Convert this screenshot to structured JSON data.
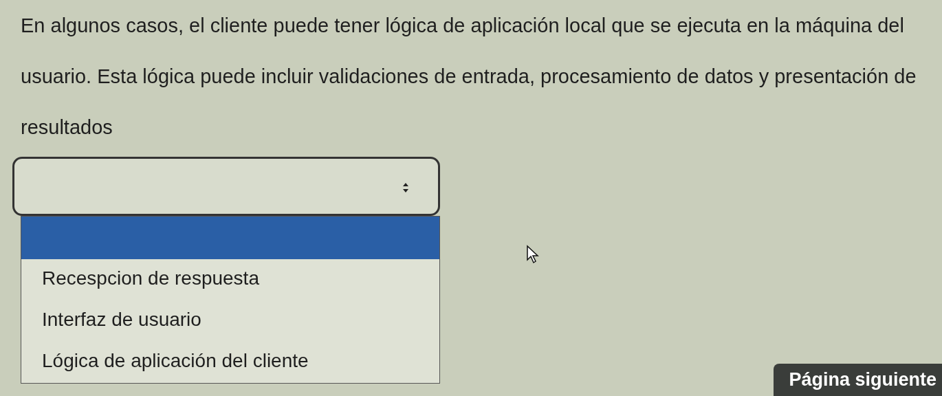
{
  "paragraph": "En algunos casos, el cliente puede tener lógica de aplicación local que se ejecuta en la máquina del usuario. Esta lógica puede incluir validaciones de entrada, procesamiento de datos y presentación de resultados",
  "select": {
    "expanded": true,
    "blank_highlighted": true,
    "options": [
      {
        "label": "Recespcion de respuesta",
        "selected": false
      },
      {
        "label": "Interfaz de usuario",
        "selected": false
      },
      {
        "label": "Lógica de aplicación del cliente",
        "selected": false
      }
    ]
  },
  "next_button": "Página siguiente"
}
